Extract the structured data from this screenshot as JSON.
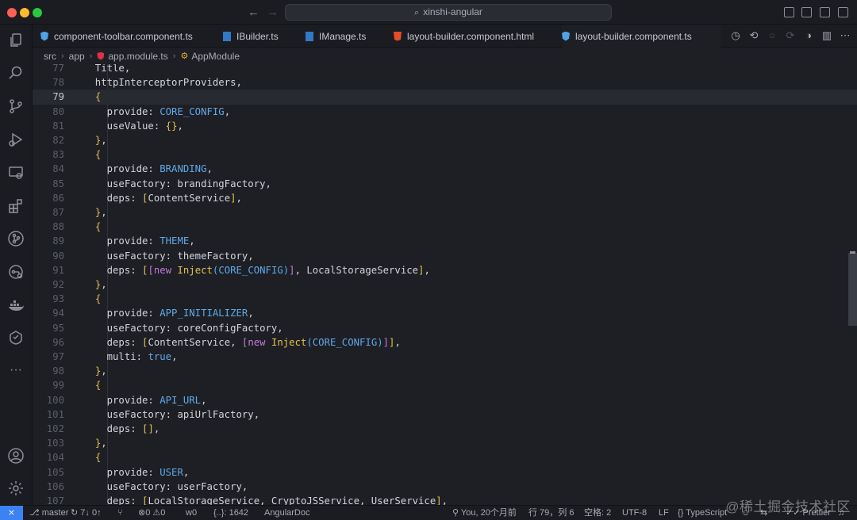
{
  "window": {
    "search_title": "xinshi-angular",
    "back_arrow": "←",
    "forward_arrow": "→"
  },
  "tabs": [
    {
      "label": "component-toolbar.component.ts",
      "icon": "angular-icon"
    },
    {
      "label": "IBuilder.ts",
      "icon": "typescript-icon"
    },
    {
      "label": "IManage.ts",
      "icon": "typescript-icon"
    },
    {
      "label": "layout-builder.component.html",
      "icon": "html5-icon"
    },
    {
      "label": "layout-builder.component.ts",
      "icon": "angular-icon"
    }
  ],
  "breadcrumb": {
    "items": [
      "src",
      "app",
      "app.module.ts",
      "AppModule"
    ]
  },
  "editor": {
    "current_line": 79,
    "lines": [
      {
        "n": "77",
        "text": "  Title,"
      },
      {
        "n": "78",
        "text": "  httpInterceptorProviders,"
      },
      {
        "n": "79",
        "text": "  {"
      },
      {
        "n": "80",
        "text": "    provide: CORE_CONFIG,"
      },
      {
        "n": "81",
        "text": "    useValue: {},"
      },
      {
        "n": "82",
        "text": "  },"
      },
      {
        "n": "83",
        "text": "  {"
      },
      {
        "n": "84",
        "text": "    provide: BRANDING,"
      },
      {
        "n": "85",
        "text": "    useFactory: brandingFactory,"
      },
      {
        "n": "86",
        "text": "    deps: [ContentService],"
      },
      {
        "n": "87",
        "text": "  },"
      },
      {
        "n": "88",
        "text": "  {"
      },
      {
        "n": "89",
        "text": "    provide: THEME,"
      },
      {
        "n": "90",
        "text": "    useFactory: themeFactory,"
      },
      {
        "n": "91",
        "text": "    deps: [[new Inject(CORE_CONFIG)], LocalStorageService],"
      },
      {
        "n": "92",
        "text": "  },"
      },
      {
        "n": "93",
        "text": "  {"
      },
      {
        "n": "94",
        "text": "    provide: APP_INITIALIZER,"
      },
      {
        "n": "95",
        "text": "    useFactory: coreConfigFactory,"
      },
      {
        "n": "96",
        "text": "    deps: [ContentService, [new Inject(CORE_CONFIG)]],"
      },
      {
        "n": "97",
        "text": "    multi: true,"
      },
      {
        "n": "98",
        "text": "  },"
      },
      {
        "n": "99",
        "text": "  {"
      },
      {
        "n": "100",
        "text": "    provide: API_URL,"
      },
      {
        "n": "101",
        "text": "    useFactory: apiUrlFactory,"
      },
      {
        "n": "102",
        "text": "    deps: [],"
      },
      {
        "n": "103",
        "text": "  },"
      },
      {
        "n": "104",
        "text": "  {"
      },
      {
        "n": "105",
        "text": "    provide: USER,"
      },
      {
        "n": "106",
        "text": "    useFactory: userFactory,"
      },
      {
        "n": "107",
        "text": "    deps: [LocalStorageService, CryptoJSService, UserService],"
      }
    ]
  },
  "status": {
    "remote_icon": "⨯",
    "branch": "master",
    "sync": "7↓ 0↑",
    "errors": "0",
    "warnings": "0",
    "ports": "0",
    "braces": "{..}: 1642",
    "angular_doc": "AngularDoc",
    "blame": "You, 20个月前",
    "cursor": "行 79，列 6",
    "spaces": "空格: 2",
    "encoding": "UTF-8",
    "eol": "LF",
    "language": "TypeScript",
    "prettier": "Prettier"
  },
  "watermark": "@稀土掘金技术社区",
  "colors": {
    "accent": "#3b82f6",
    "angular": "#dd3245",
    "bracket_yellow": "#e4c04a",
    "keyword_purple": "#c678dd",
    "constant_blue": "#5fa8e8"
  }
}
